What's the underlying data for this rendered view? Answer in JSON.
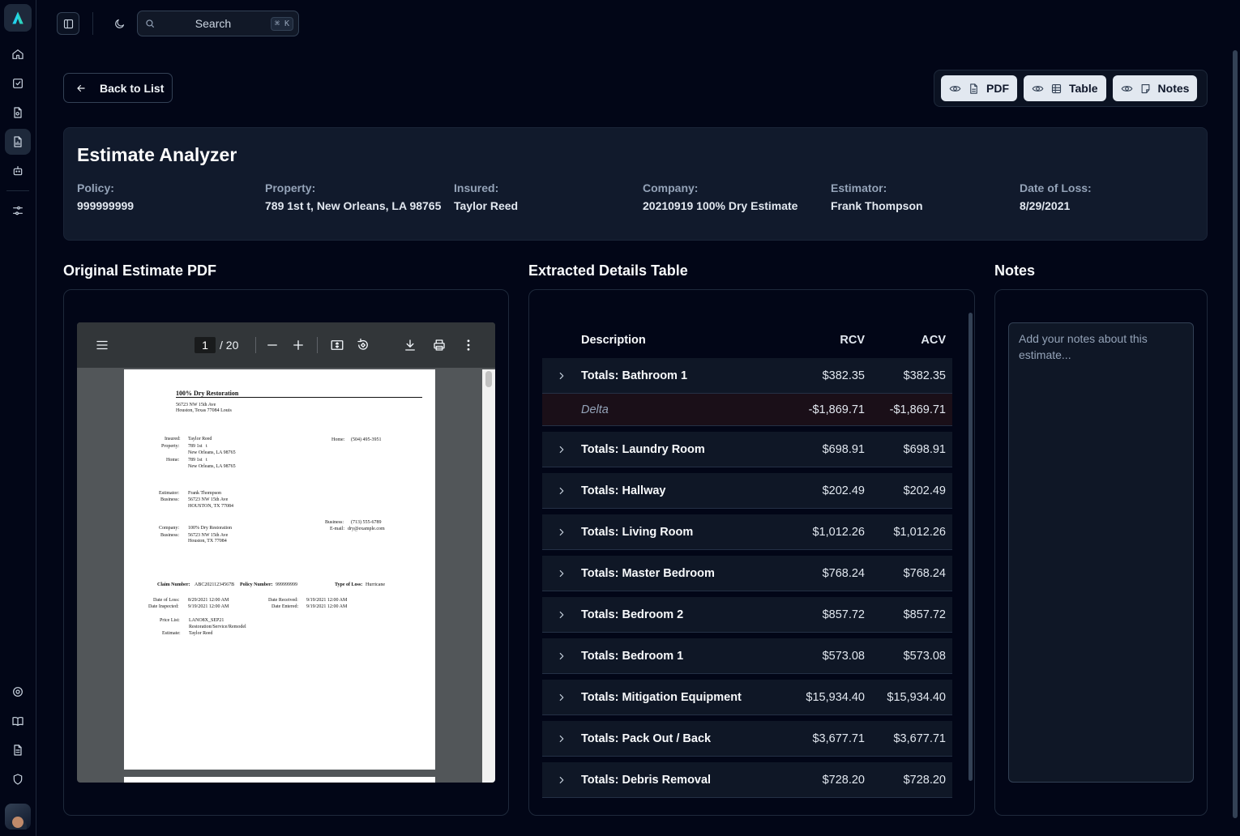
{
  "search": {
    "placeholder": "Search",
    "shortcut": "⌘ K"
  },
  "back_label": "Back to List",
  "view_toggles": [
    {
      "label": "PDF",
      "icon": "file-icon"
    },
    {
      "label": "Table",
      "icon": "table-icon"
    },
    {
      "label": "Notes",
      "icon": "sticky-note-icon"
    }
  ],
  "estimate": {
    "title": "Estimate Analyzer",
    "fields": [
      {
        "label": "Policy:",
        "value": "999999999"
      },
      {
        "label": "Property:",
        "value": "789 1st t, New Orleans, LA 98765"
      },
      {
        "label": "Insured:",
        "value": "Taylor Reed"
      },
      {
        "label": "Company:",
        "value": "20210919 100% Dry Estimate"
      },
      {
        "label": "Estimator:",
        "value": "Frank Thompson"
      },
      {
        "label": "Date of Loss:",
        "value": "8/29/2021"
      }
    ]
  },
  "sections": {
    "pdf_title": "Original Estimate PDF",
    "table_title": "Extracted Details Table",
    "notes_title": "Notes"
  },
  "pdf_viewer": {
    "current_page": "1",
    "total_pages": "/ 20",
    "document": {
      "company": "100% Dry Restoration",
      "company_addr1": "56723 NW 15th Ave",
      "company_addr2": "Houston, Texas 77084 Louis",
      "insured_label": "Insured:",
      "insured": "Taylor Reed",
      "property_label": "Property:",
      "property1": "789 1st   t",
      "property2": "New Orleans, LA 98765",
      "home_label": "Home:",
      "home1": "789 1st   t",
      "home2": "New Orleans, LA 98765",
      "home_phone_label": "Home:",
      "home_phone": "(504) 495-3951",
      "estimator_label": "Estimator:",
      "estimator": "Frank Thompson",
      "business_label": "Business:",
      "business1": "56723 NW 15th Ave",
      "business2": "HOUSTON, TX 77084",
      "bus_phone_label": "Business:",
      "bus_phone": "(713) 555-6789",
      "email_label": "E-mail:",
      "email": "dry@example.com",
      "company_label": "Company:",
      "company2": "100% Dry Restoration",
      "business_label2": "Business:",
      "cbusiness1": "56723 NW 15th Ave",
      "cbusiness2": "Houston, TX 77084",
      "claim_label": "Claim Number:",
      "claim": "ABC20211234567B",
      "policy_label": "Policy Number:",
      "policy": "999999999",
      "loss_type_label": "Type of Loss:",
      "loss_type": "Hurricane",
      "dol_label": "Date of Loss:",
      "dol": "8/29/2021 12:00 AM",
      "dinsp_label": "Date Inspected:",
      "dinsp": "9/19/2021 12:00 AM",
      "drec_label": "Date Received:",
      "drec": "9/19/2021 12:00 AM",
      "dent_label": "Date Entered:",
      "dent": "9/19/2021 12:00 AM",
      "price_label": "Price List:",
      "price1": "LANO8X_SEP21",
      "price2": "Restoration/Service/Remodel",
      "est_label": "Estimate:",
      "est": "Taylor Reed"
    }
  },
  "table": {
    "headers": [
      "Description",
      "RCV",
      "ACV"
    ],
    "rows": [
      {
        "desc": "Totals: Bathroom 1",
        "rcv": "$382.35",
        "acv": "$382.35"
      },
      {
        "desc": "Delta",
        "rcv": "-$1,869.71",
        "acv": "-$1,869.71",
        "delta": true
      },
      {
        "desc": "Totals: Laundry Room",
        "rcv": "$698.91",
        "acv": "$698.91"
      },
      {
        "desc": "Totals: Hallway",
        "rcv": "$202.49",
        "acv": "$202.49"
      },
      {
        "desc": "Totals: Living Room",
        "rcv": "$1,012.26",
        "acv": "$1,012.26"
      },
      {
        "desc": "Totals: Master Bedroom",
        "rcv": "$768.24",
        "acv": "$768.24"
      },
      {
        "desc": "Totals: Bedroom 2",
        "rcv": "$857.72",
        "acv": "$857.72"
      },
      {
        "desc": "Totals: Bedroom 1",
        "rcv": "$573.08",
        "acv": "$573.08"
      },
      {
        "desc": "Totals: Mitigation Equipment",
        "rcv": "$15,934.40",
        "acv": "$15,934.40"
      },
      {
        "desc": "Totals: Pack Out / Back",
        "rcv": "$3,677.71",
        "acv": "$3,677.71"
      },
      {
        "desc": "Totals: Debris Removal",
        "rcv": "$728.20",
        "acv": "$728.20"
      }
    ]
  },
  "notes": {
    "placeholder": "Add your notes about this estimate..."
  }
}
